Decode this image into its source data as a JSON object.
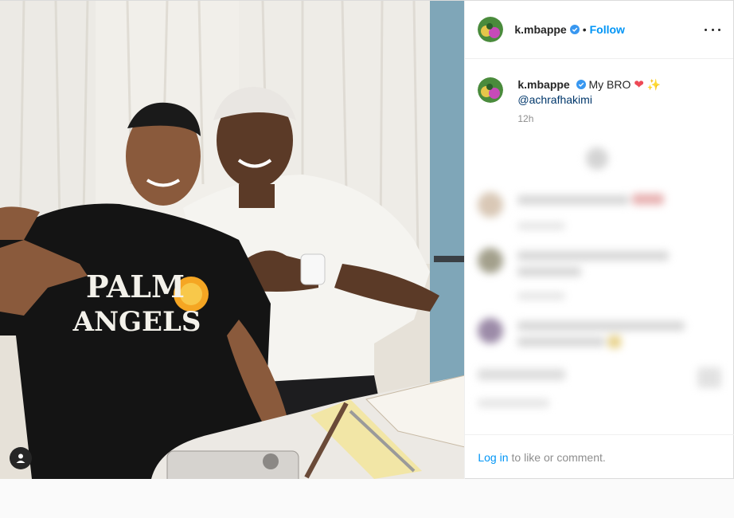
{
  "post": {
    "author": "k.mbappe",
    "follow_label": "Follow",
    "dot": "•",
    "caption_text": "My BRO",
    "caption_emojis": [
      "❤",
      "✨"
    ],
    "mention": "@achrafhakimi",
    "time": "12h"
  },
  "image": {
    "shirt_text_line1": "PALM",
    "shirt_text_line2": "ANGELS"
  },
  "footer": {
    "login_label": "Log in",
    "suffix": "to like or comment."
  },
  "colors": {
    "accent": "#0095f6",
    "verified": "#3897f0",
    "heart": "#ed4956"
  },
  "icons": {
    "more": "more-options-icon",
    "verified": "verified-badge-icon",
    "tagged": "tagged-user-icon"
  }
}
